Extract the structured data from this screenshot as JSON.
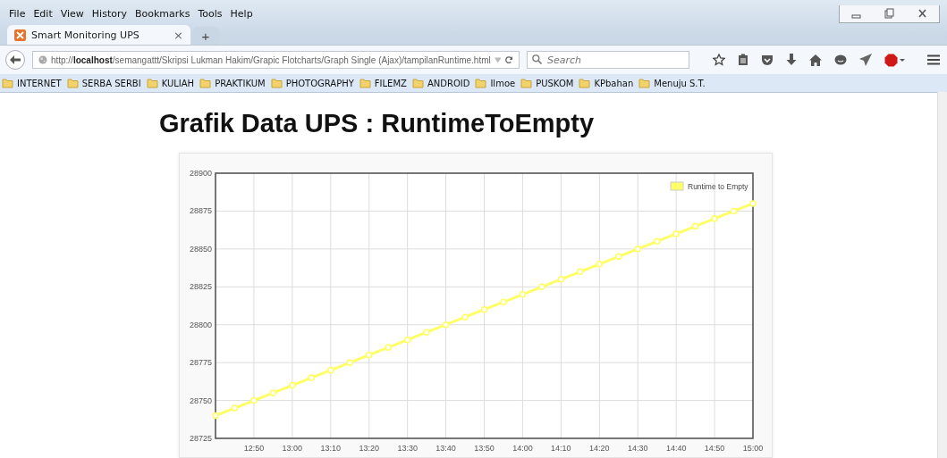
{
  "menu": [
    "File",
    "Edit",
    "View",
    "History",
    "Bookmarks",
    "Tools",
    "Help"
  ],
  "tabs": [
    {
      "title": "Smart Monitoring UPS",
      "close": "×",
      "selected": true
    }
  ],
  "new_tab": "+",
  "address": {
    "url": "http://**localhost**/semangattt/Skripsi Lukman Hakim/Grapic Flotcharts/Graph Single (Ajax)/tampilanRuntime.html"
  },
  "search": {
    "placeholder": "Search"
  },
  "bookmarks": [
    "INTERNET",
    "SERBA SERBI",
    "KULIAH",
    "PRAKTIKUM",
    "PHOTOGRAPHY",
    "FILEMZ",
    "ANDROID",
    "Ilmoe",
    "PUSKOM",
    "KPbahan",
    "Menuju S.T."
  ],
  "page": {
    "title": "Grafik Data UPS : RuntimeToEmpty",
    "chart_data": {
      "type": "line",
      "grid": true,
      "x": [
        760,
        765,
        770,
        775,
        780,
        785,
        790,
        795,
        800,
        805,
        810,
        815,
        820,
        825,
        830,
        835,
        840,
        845,
        850,
        855,
        860,
        865,
        870,
        875,
        880,
        885,
        890,
        895,
        900
      ],
      "series": [
        {
          "name": "Runtime to Empty",
          "color": "#ffff66",
          "marker": true,
          "values": [
            28740,
            28745,
            28750,
            28755,
            28760,
            28765,
            28770,
            28775,
            28780,
            28785,
            28790,
            28795,
            28800,
            28805,
            28810,
            28815,
            28820,
            28825,
            28830,
            28835,
            28840,
            28845,
            28850,
            28855,
            28860,
            28865,
            28870,
            28875,
            28880
          ]
        }
      ],
      "xlim": [
        760,
        900
      ],
      "ylim": [
        28725,
        28900
      ],
      "xticks": [
        {
          "value": 770,
          "label": "12:50"
        },
        {
          "value": 780,
          "label": "13:00"
        },
        {
          "value": 790,
          "label": "13:10"
        },
        {
          "value": 800,
          "label": "13:20"
        },
        {
          "value": 810,
          "label": "13:30"
        },
        {
          "value": 820,
          "label": "13:40"
        },
        {
          "value": 830,
          "label": "13:50"
        },
        {
          "value": 840,
          "label": "14:00"
        },
        {
          "value": 850,
          "label": "14:10"
        },
        {
          "value": 860,
          "label": "14:20"
        },
        {
          "value": 870,
          "label": "14:30"
        },
        {
          "value": 880,
          "label": "14:40"
        },
        {
          "value": 890,
          "label": "14:50"
        },
        {
          "value": 900,
          "label": "15:00"
        }
      ],
      "yticks": [
        28725,
        28750,
        28775,
        28800,
        28825,
        28850,
        28875,
        28900
      ]
    }
  }
}
